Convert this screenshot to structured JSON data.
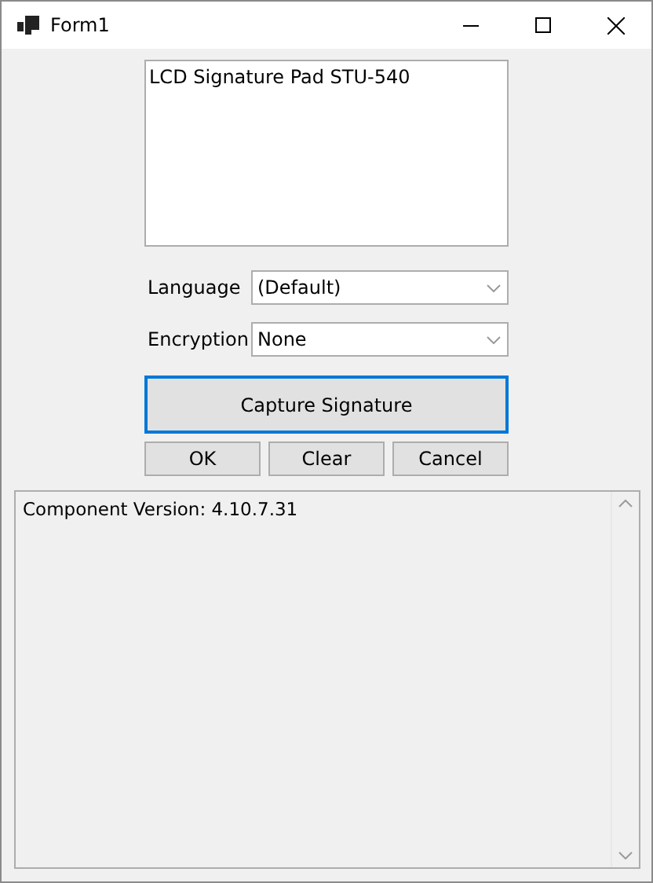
{
  "window": {
    "title": "Form1"
  },
  "device_list": {
    "items": [
      "LCD Signature Pad STU-540"
    ]
  },
  "fields": [
    {
      "label": "Language",
      "value": "(Default)"
    },
    {
      "label": "Encryption",
      "value": "None"
    }
  ],
  "capture_button": {
    "label": "Capture Signature",
    "focused": true
  },
  "buttons": [
    "OK",
    "Clear",
    "Cancel"
  ],
  "log": {
    "lines": [
      "Component Version: 4.10.7.31"
    ]
  }
}
